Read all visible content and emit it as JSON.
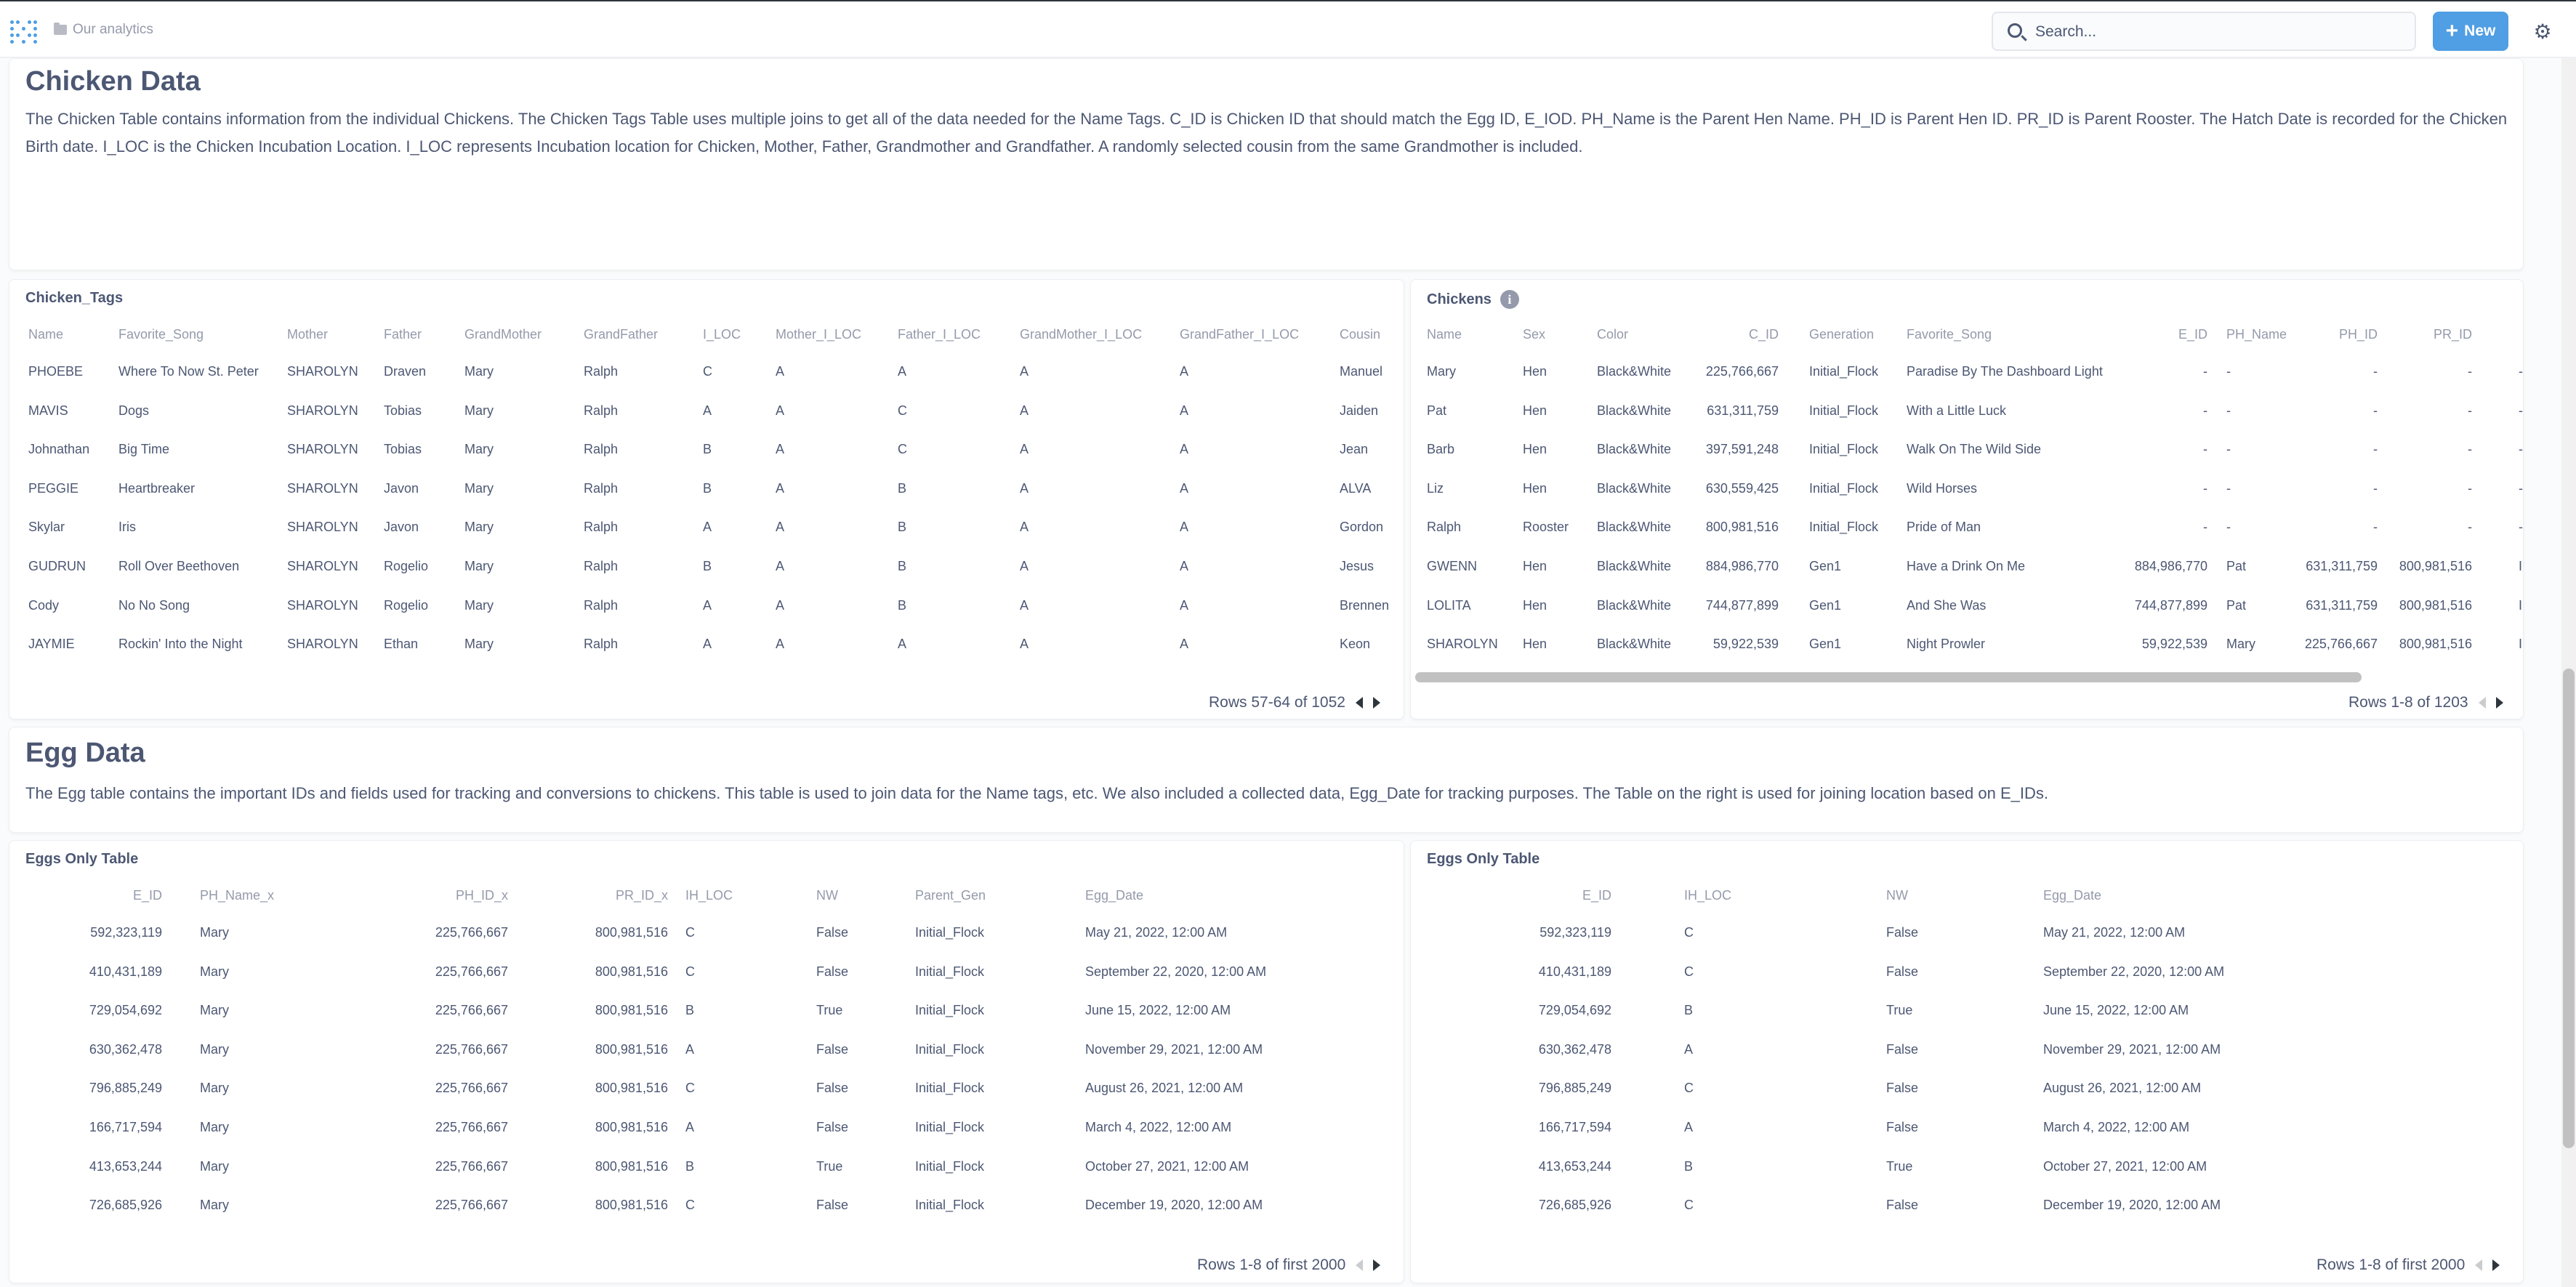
{
  "header": {
    "breadcrumb": "Our analytics",
    "search_placeholder": "Search...",
    "new_label": "New"
  },
  "chicken_text": {
    "title": "Chicken Data",
    "body": "The Chicken Table contains information from the individual Chickens. The Chicken Tags Table uses multiple joins to get all of the data needed for the Name Tags. C_ID is Chicken ID that should match the Egg ID, E_IOD. PH_Name is the Parent Hen Name. PH_ID is Parent Hen ID. PR_ID is Parent Rooster. The Hatch Date is recorded for the Chicken Birth date. I_LOC is the Chicken Incubation Location. I_LOC represents Incubation location for Chicken, Mother, Father, Grandmother and Grandfather. A randomly selected cousin from the same Grandmother is included."
  },
  "chicken_tags": {
    "title": "Chicken_Tags",
    "columns": [
      "Name",
      "Favorite_Song",
      "Mother",
      "Father",
      "GrandMother",
      "GrandFather",
      "I_LOC",
      "Mother_I_LOC",
      "Father_I_LOC",
      "GrandMother_I_LOC",
      "GrandFather_I_LOC",
      "Cousin"
    ],
    "rows": [
      [
        "PHOEBE",
        "Where To Now St. Peter",
        "SHAROLYN",
        "Draven",
        "Mary",
        "Ralph",
        "C",
        "A",
        "A",
        "A",
        "A",
        "Manuel"
      ],
      [
        "MAVIS",
        "Dogs",
        "SHAROLYN",
        "Tobias",
        "Mary",
        "Ralph",
        "A",
        "A",
        "C",
        "A",
        "A",
        "Jaiden"
      ],
      [
        "Johnathan",
        "Big Time",
        "SHAROLYN",
        "Tobias",
        "Mary",
        "Ralph",
        "B",
        "A",
        "C",
        "A",
        "A",
        "Jean"
      ],
      [
        "PEGGIE",
        "Heartbreaker",
        "SHAROLYN",
        "Javon",
        "Mary",
        "Ralph",
        "B",
        "A",
        "B",
        "A",
        "A",
        "ALVA"
      ],
      [
        "Skylar",
        "Iris",
        "SHAROLYN",
        "Javon",
        "Mary",
        "Ralph",
        "A",
        "A",
        "B",
        "A",
        "A",
        "Gordon"
      ],
      [
        "GUDRUN",
        "Roll Over Beethoven",
        "SHAROLYN",
        "Rogelio",
        "Mary",
        "Ralph",
        "B",
        "A",
        "B",
        "A",
        "A",
        "Jesus"
      ],
      [
        "Cody",
        "No No Song",
        "SHAROLYN",
        "Rogelio",
        "Mary",
        "Ralph",
        "A",
        "A",
        "B",
        "A",
        "A",
        "Brennen"
      ],
      [
        "JAYMIE",
        "Rockin' Into the Night",
        "SHAROLYN",
        "Ethan",
        "Mary",
        "Ralph",
        "A",
        "A",
        "A",
        "A",
        "A",
        "Keon"
      ]
    ],
    "footer": "Rows 57-64 of 1052"
  },
  "chickens": {
    "title": "Chickens",
    "columns": [
      "Name",
      "Sex",
      "Color",
      "C_ID",
      "Generation",
      "Favorite_Song",
      "E_ID",
      "PH_Name",
      "PH_ID",
      "PR_ID",
      ""
    ],
    "rows": [
      [
        "Mary",
        "Hen",
        "Black&White",
        "225,766,667",
        "Initial_Flock",
        "Paradise By The Dashboard Light",
        "-",
        "-",
        "-",
        "-",
        "-"
      ],
      [
        "Pat",
        "Hen",
        "Black&White",
        "631,311,759",
        "Initial_Flock",
        "With a Little Luck",
        "-",
        "-",
        "-",
        "-",
        "-"
      ],
      [
        "Barb",
        "Hen",
        "Black&White",
        "397,591,248",
        "Initial_Flock",
        "Walk On The Wild Side",
        "-",
        "-",
        "-",
        "-",
        "-"
      ],
      [
        "Liz",
        "Hen",
        "Black&White",
        "630,559,425",
        "Initial_Flock",
        "Wild Horses",
        "-",
        "-",
        "-",
        "-",
        "-"
      ],
      [
        "Ralph",
        "Rooster",
        "Black&White",
        "800,981,516",
        "Initial_Flock",
        "Pride of Man",
        "-",
        "-",
        "-",
        "-",
        "-"
      ],
      [
        "GWENN",
        "Hen",
        "Black&White",
        "884,986,770",
        "Gen1",
        "Have a Drink On Me",
        "884,986,770",
        "Pat",
        "631,311,759",
        "800,981,516",
        "I"
      ],
      [
        "LOLITA",
        "Hen",
        "Black&White",
        "744,877,899",
        "Gen1",
        "And She Was",
        "744,877,899",
        "Pat",
        "631,311,759",
        "800,981,516",
        "I"
      ],
      [
        "SHAROLYN",
        "Hen",
        "Black&White",
        "59,922,539",
        "Gen1",
        "Night Prowler",
        "59,922,539",
        "Mary",
        "225,766,667",
        "800,981,516",
        "I"
      ]
    ],
    "footer": "Rows 1-8 of 1203"
  },
  "egg_text": {
    "title": "Egg Data",
    "body": "The Egg table contains the important IDs and fields used for tracking and conversions to chickens. This table is used to join data for the Name tags, etc. We also included a collected data, Egg_Date for tracking purposes. The Table on the right is used for joining location based on E_IDs."
  },
  "eggs_left": {
    "title": "Eggs Only Table",
    "columns": [
      "E_ID",
      "PH_Name_x",
      "PH_ID_x",
      "PR_ID_x",
      "IH_LOC",
      "NW",
      "Parent_Gen",
      "Egg_Date"
    ],
    "rows": [
      [
        "592,323,119",
        "Mary",
        "225,766,667",
        "800,981,516",
        "C",
        "False",
        "Initial_Flock",
        "May 21, 2022, 12:00 AM"
      ],
      [
        "410,431,189",
        "Mary",
        "225,766,667",
        "800,981,516",
        "C",
        "False",
        "Initial_Flock",
        "September 22, 2020, 12:00 AM"
      ],
      [
        "729,054,692",
        "Mary",
        "225,766,667",
        "800,981,516",
        "B",
        "True",
        "Initial_Flock",
        "June 15, 2022, 12:00 AM"
      ],
      [
        "630,362,478",
        "Mary",
        "225,766,667",
        "800,981,516",
        "A",
        "False",
        "Initial_Flock",
        "November 29, 2021, 12:00 AM"
      ],
      [
        "796,885,249",
        "Mary",
        "225,766,667",
        "800,981,516",
        "C",
        "False",
        "Initial_Flock",
        "August 26, 2021, 12:00 AM"
      ],
      [
        "166,717,594",
        "Mary",
        "225,766,667",
        "800,981,516",
        "A",
        "False",
        "Initial_Flock",
        "March 4, 2022, 12:00 AM"
      ],
      [
        "413,653,244",
        "Mary",
        "225,766,667",
        "800,981,516",
        "B",
        "True",
        "Initial_Flock",
        "October 27, 2021, 12:00 AM"
      ],
      [
        "726,685,926",
        "Mary",
        "225,766,667",
        "800,981,516",
        "C",
        "False",
        "Initial_Flock",
        "December 19, 2020, 12:00 AM"
      ]
    ],
    "footer": "Rows 1-8 of first 2000"
  },
  "eggs_right": {
    "title": "Eggs Only Table",
    "columns": [
      "E_ID",
      "IH_LOC",
      "NW",
      "Egg_Date"
    ],
    "rows": [
      [
        "592,323,119",
        "C",
        "False",
        "May 21, 2022, 12:00 AM"
      ],
      [
        "410,431,189",
        "C",
        "False",
        "September 22, 2020, 12:00 AM"
      ],
      [
        "729,054,692",
        "B",
        "True",
        "June 15, 2022, 12:00 AM"
      ],
      [
        "630,362,478",
        "A",
        "False",
        "November 29, 2021, 12:00 AM"
      ],
      [
        "796,885,249",
        "C",
        "False",
        "August 26, 2021, 12:00 AM"
      ],
      [
        "166,717,594",
        "A",
        "False",
        "March 4, 2022, 12:00 AM"
      ],
      [
        "413,653,244",
        "B",
        "True",
        "October 27, 2021, 12:00 AM"
      ],
      [
        "726,685,926",
        "C",
        "False",
        "December 19, 2020, 12:00 AM"
      ]
    ],
    "footer": "Rows 1-8 of first 2000"
  }
}
